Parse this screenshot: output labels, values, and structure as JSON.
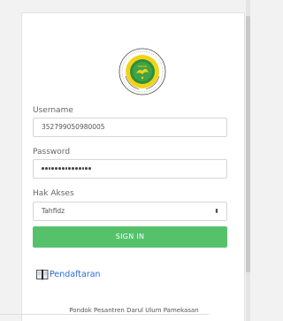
{
  "form": {
    "username": {
      "label": "Username",
      "value": "352799050980005"
    },
    "password": {
      "label": "Password",
      "masked_length": 15
    },
    "access": {
      "label": "Hak Akses",
      "selected": "Tahfidz"
    },
    "submit_label": "SIGN IN"
  },
  "register_link": {
    "label": "Pendaftaran",
    "icon": "book-icon"
  },
  "footer_text": "Pondok Pesantren Darul Ulum Pamekasan",
  "logo": {
    "icon": "institution-emblem"
  },
  "colors": {
    "accent_green": "#55c16b",
    "link_blue": "#2a6fd6",
    "emblem_green": "#2f8f3a",
    "emblem_yellow": "#f2d31a",
    "background": "#f2f2f2",
    "card": "#ffffff"
  }
}
